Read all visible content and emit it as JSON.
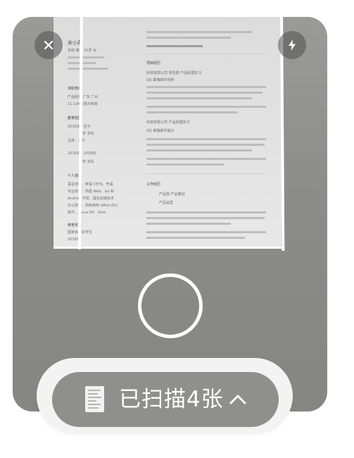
{
  "scanner": {
    "close_icon": "close-icon",
    "flash_icon": "lightning-icon",
    "shutter_icon": "shutter-ring"
  },
  "document": {
    "name": "宋小燕",
    "contact": "年龄 籍贯 21岁 女",
    "sections": {
      "intent": "求职意向",
      "intent_lines": [
        "产品经理  广东 广州",
        "11-13K  1周内到岗"
      ],
      "education": "教育经历",
      "education_lines": [
        "2019年 - 至今",
        "大学  本科",
        "主修：设计",
        "2016年 - 2018年",
        "大学  本科"
      ],
      "personal": "个人技能",
      "personal_lines": [
        "语言技能：英语 CET6、粤语",
        "专业技能：熟悉 Web、ios 和",
        "Android 开发，擅长前端技术",
        "办公技能：熟练使用 office 办公",
        "软件、Axure RP、Visio"
      ],
      "awards": "荣誉奖项",
      "award_lines": [
        "国家级三好学生",
        "2019年"
      ],
      "project": "项目经历",
      "project_lines": [
        "科技有限公司  研发部  产品经理实习",
        "QQ 邮箱邮件排序",
        "科技有限公司  产品经理实习",
        "QQ 邮箱邮件提示"
      ],
      "work": "工作经历",
      "work_lines": [
        "产品部  产品策划",
        "产品运营"
      ]
    }
  },
  "scan_bar": {
    "label": "已扫描4张",
    "expand_icon": "chevron-up-icon",
    "count": 4
  }
}
